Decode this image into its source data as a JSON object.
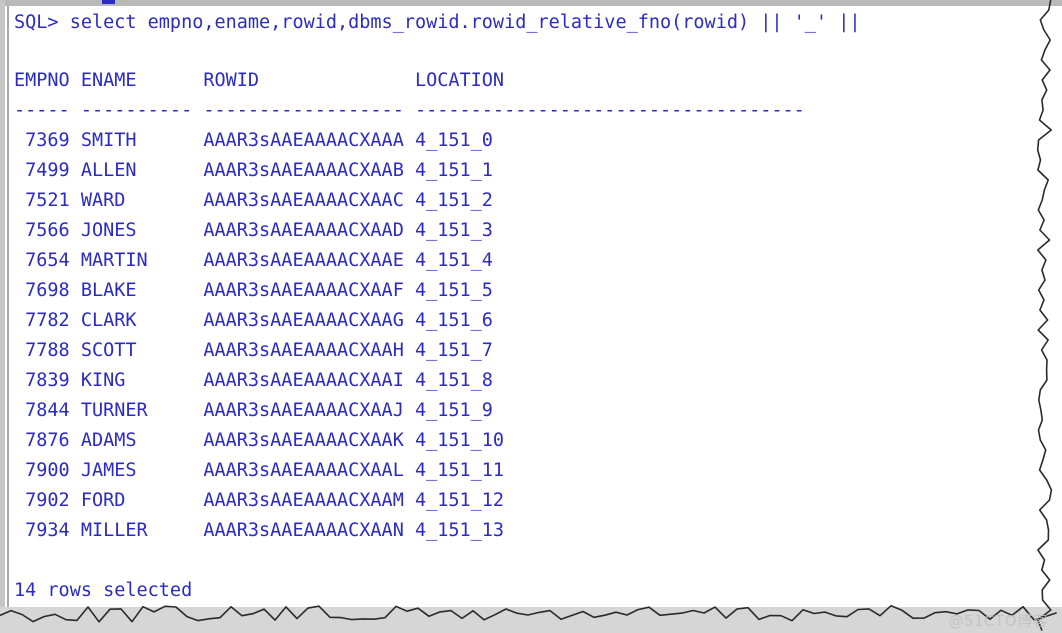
{
  "terminal": {
    "prompt_line": "SQL> select empno,ename,rowid,dbms_rowid.rowid_relative_fno(rowid) || '_' ||",
    "headers": [
      "EMPNO",
      "ENAME",
      "ROWID",
      "LOCATION"
    ],
    "separator": "----- ---------- ------------------ -----------------------------------",
    "footer": "14 rows selected",
    "text_color": "#2b2bc4",
    "background_color": "#ffffff",
    "rows": [
      {
        "empno": "7369",
        "ename": "SMITH",
        "rowid": "AAAR3sAAEAAAACXAAA",
        "location": "4_151_0"
      },
      {
        "empno": "7499",
        "ename": "ALLEN",
        "rowid": "AAAR3sAAEAAAACXAAB",
        "location": "4_151_1"
      },
      {
        "empno": "7521",
        "ename": "WARD",
        "rowid": "AAAR3sAAEAAAACXAAC",
        "location": "4_151_2"
      },
      {
        "empno": "7566",
        "ename": "JONES",
        "rowid": "AAAR3sAAEAAAACXAAD",
        "location": "4_151_3"
      },
      {
        "empno": "7654",
        "ename": "MARTIN",
        "rowid": "AAAR3sAAEAAAACXAAE",
        "location": "4_151_4"
      },
      {
        "empno": "7698",
        "ename": "BLAKE",
        "rowid": "AAAR3sAAEAAAACXAAF",
        "location": "4_151_5"
      },
      {
        "empno": "7782",
        "ename": "CLARK",
        "rowid": "AAAR3sAAEAAAACXAAG",
        "location": "4_151_6"
      },
      {
        "empno": "7788",
        "ename": "SCOTT",
        "rowid": "AAAR3sAAEAAAACXAAH",
        "location": "4_151_7"
      },
      {
        "empno": "7839",
        "ename": "KING",
        "rowid": "AAAR3sAAEAAAACXAAI",
        "location": "4_151_8"
      },
      {
        "empno": "7844",
        "ename": "TURNER",
        "rowid": "AAAR3sAAEAAAACXAAJ",
        "location": "4_151_9"
      },
      {
        "empno": "7876",
        "ename": "ADAMS",
        "rowid": "AAAR3sAAEAAAACXAAK",
        "location": "4_151_10"
      },
      {
        "empno": "7900",
        "ename": "JAMES",
        "rowid": "AAAR3sAAEAAAACXAAL",
        "location": "4_151_11"
      },
      {
        "empno": "7902",
        "ename": "FORD",
        "rowid": "AAAR3sAAEAAAACXAAM",
        "location": "4_151_12"
      },
      {
        "empno": "7934",
        "ename": "MILLER",
        "rowid": "AAAR3sAAEAAAACXAAN",
        "location": "4_151_13"
      }
    ]
  },
  "watermark": {
    "text": "@51CTO博客"
  }
}
